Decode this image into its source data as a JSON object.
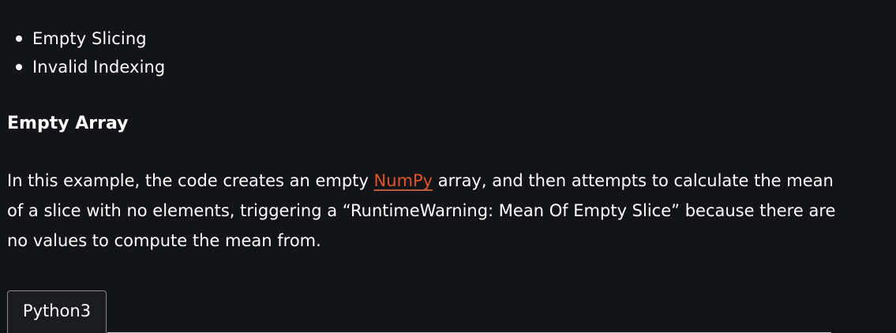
{
  "bullets": [
    {
      "label": "Empty Slicing"
    },
    {
      "label": "Invalid Indexing"
    }
  ],
  "section": {
    "heading": "Empty Array",
    "paragraph": {
      "before_link": "In this example, the code creates an empty ",
      "link_text": "NumPy",
      "after_link": " array, and then attempts to calculate the mean of a slice with no elements, triggering a “RuntimeWarning: Mean Of Empty Slice” because there are no values to compute the mean from."
    }
  },
  "code_tabs": [
    {
      "label": "Python3",
      "selected": true
    }
  ],
  "colors": {
    "background": "#131417",
    "text": "#ffffff",
    "link": "#e0542a"
  }
}
